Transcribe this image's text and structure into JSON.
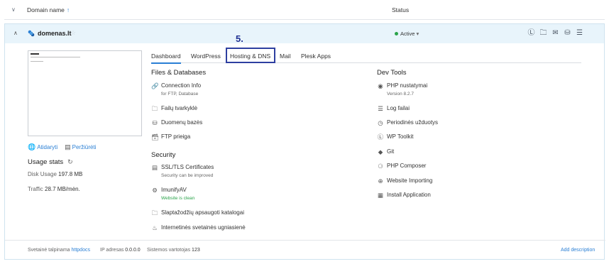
{
  "header": {
    "domain_col": "Domain name",
    "sort_icon": "↑",
    "status_col": "Status"
  },
  "domain": {
    "name": "domenas.lt",
    "status": "Active"
  },
  "thumbnail": {},
  "links": {
    "open": "Atidaryti",
    "preview": "Peržiūrėti"
  },
  "usage": {
    "title": "Usage stats",
    "disk_label": "Disk Usage",
    "disk_value": "197.8 MB",
    "traffic_label": "Traffic",
    "traffic_value": "28.7 MB/mėn."
  },
  "tabs": [
    "Dashboard",
    "WordPress",
    "Hosting & DNS",
    "Mail",
    "Plesk Apps"
  ],
  "step_marker": "5.",
  "files": {
    "title": "Files & Databases",
    "items": [
      {
        "label": "Connection Info",
        "sub": "for FTP, Database",
        "icon": "link-icon"
      },
      {
        "label": "Failų tvarkyklė",
        "icon": "folder-icon"
      },
      {
        "label": "Duomenų bazės",
        "icon": "database-icon"
      },
      {
        "label": "FTP prieiga",
        "icon": "ftp-icon"
      }
    ]
  },
  "security": {
    "title": "Security",
    "items": [
      {
        "label": "SSL/TLS Certificates",
        "sub": "Security can be improved",
        "icon": "certificate-icon"
      },
      {
        "label": "ImunifyAV",
        "sub": "Website is clean",
        "icon": "gear-icon"
      },
      {
        "label": "Slaptažodžių apsaugoti katalogai",
        "icon": "locked-folder-icon"
      },
      {
        "label": "Internetinės svetainės ugniasienė",
        "icon": "fire-icon"
      }
    ]
  },
  "devtools": {
    "title": "Dev Tools",
    "items": [
      {
        "label": "PHP nustatymai",
        "sub": "Version 8.2.7",
        "icon": "php-icon"
      },
      {
        "label": "Log failai",
        "icon": "list-icon"
      },
      {
        "label": "Periodinės užduotys",
        "icon": "clock-icon"
      },
      {
        "label": "WP Toolkit",
        "icon": "wordpress-icon"
      },
      {
        "label": "Git",
        "icon": "git-icon"
      },
      {
        "label": "PHP Composer",
        "icon": "composer-icon"
      },
      {
        "label": "Website Importing",
        "icon": "import-icon"
      },
      {
        "label": "Install Application",
        "icon": "apps-icon"
      }
    ]
  },
  "footer": {
    "hosted_label": "Svetainė talpinama",
    "hosted_value": "httpdocs",
    "ip_label": "IP adresas",
    "ip_value": "0.0.0.0",
    "user_label": "Sistemos vartotojas",
    "user_value": "123",
    "add_description": "Add description"
  },
  "colors": {
    "accent": "#2a7fd4",
    "active": "#2aa34a",
    "highlight": "#2e3fa0"
  }
}
